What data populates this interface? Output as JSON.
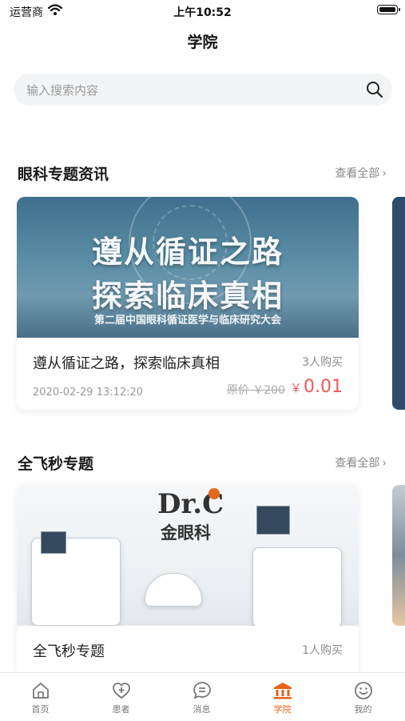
{
  "status_bar": {
    "carrier": "运营商",
    "time": "上午10:52"
  },
  "nav": {
    "title": "学院"
  },
  "search": {
    "placeholder": "输入搜索内容"
  },
  "sections": [
    {
      "title": "眼科专题资讯",
      "more_label": "查看全部",
      "card": {
        "cover_line1": "遵从循证之路",
        "cover_line2": "探索临床真相",
        "cover_subtitle": "第二届中国眼科循证医学与临床研究大会",
        "name": "遵从循证之路，探索临床真相",
        "buyers": "3人购买",
        "date": "2020-02-29 13:12:20",
        "original_price": "原价 ￥200",
        "price_symbol": "￥",
        "price": "0.01"
      }
    },
    {
      "title": "全飞秒专题",
      "more_label": "查看全部",
      "card": {
        "cover_logo": "Dr.C",
        "cover_logo_sub": "金眼科",
        "name": "全飞秒专题",
        "buyers": "1人购买"
      }
    }
  ],
  "tab_bar": [
    {
      "label": "首页",
      "icon": "home-icon",
      "active": false
    },
    {
      "label": "患者",
      "icon": "heart-plus-icon",
      "active": false
    },
    {
      "label": "消息",
      "icon": "chat-icon",
      "active": false
    },
    {
      "label": "学院",
      "icon": "academy-icon",
      "active": true
    },
    {
      "label": "我的",
      "icon": "smile-icon",
      "active": false
    }
  ],
  "colors": {
    "accent": "#e8621a",
    "price": "#f0585d",
    "search_bg": "#f3f4f6"
  }
}
